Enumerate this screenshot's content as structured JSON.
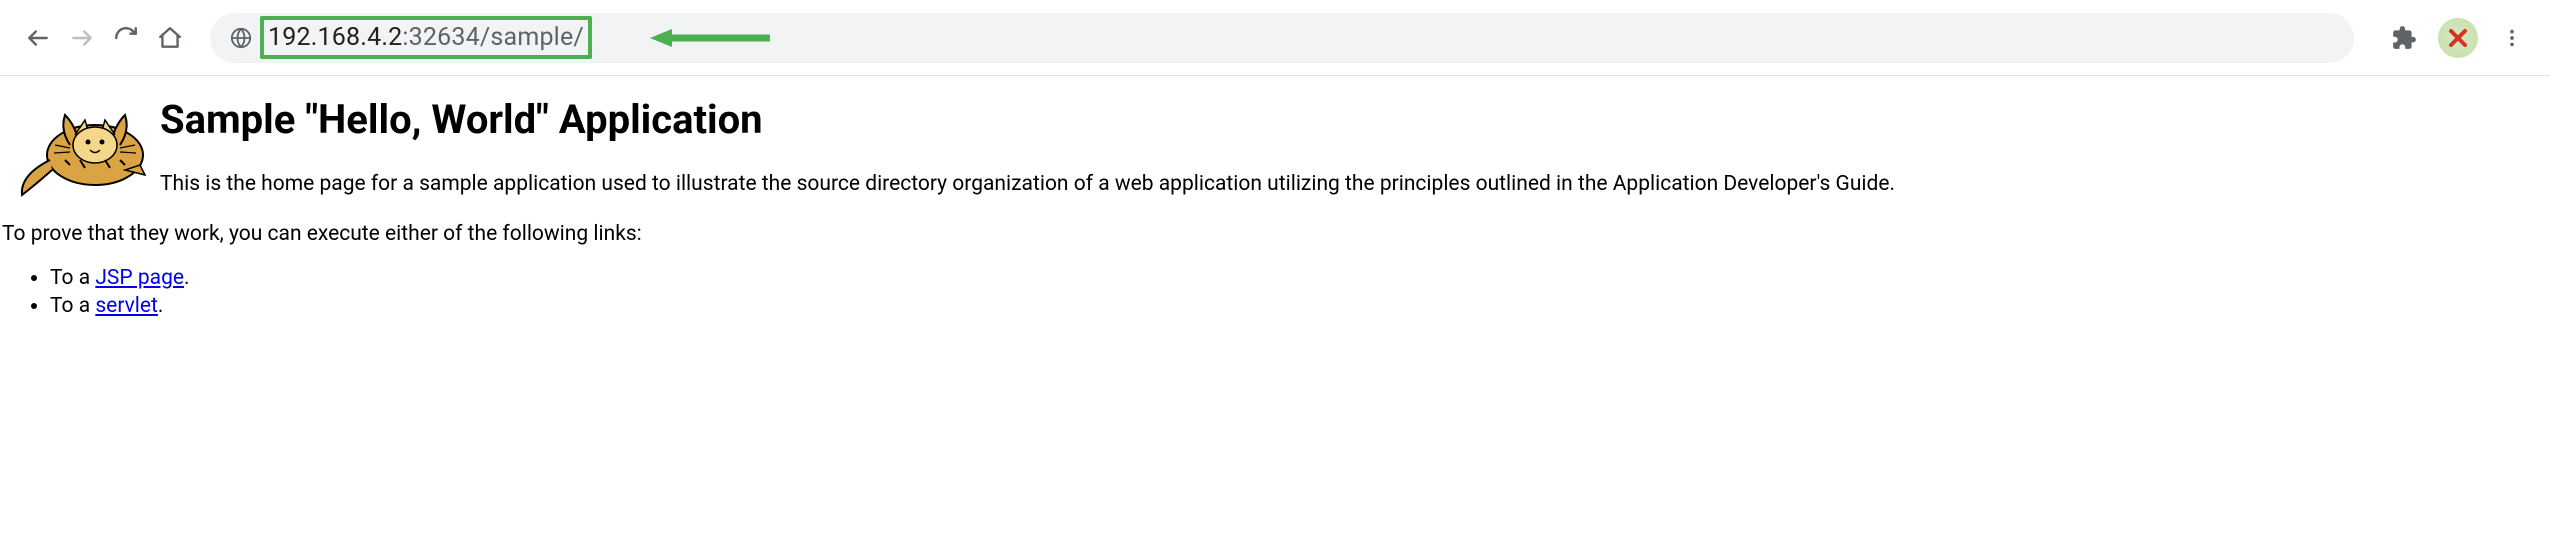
{
  "toolbar": {
    "url_host": "192.168.4.2",
    "url_port": ":32634",
    "url_path": "/sample/",
    "extension_badge": "✕"
  },
  "page": {
    "title": "Sample \"Hello, World\" Application",
    "intro": "This is the home page for a sample application used to illustrate the source directory organization of a web application utilizing the principles outlined in the Application Developer's Guide.",
    "prove": "To prove that they work, you can execute either of the following links:",
    "links": [
      {
        "prefix": "To a ",
        "label": "JSP page",
        "suffix": "."
      },
      {
        "prefix": "To a ",
        "label": "servlet",
        "suffix": "."
      }
    ]
  }
}
